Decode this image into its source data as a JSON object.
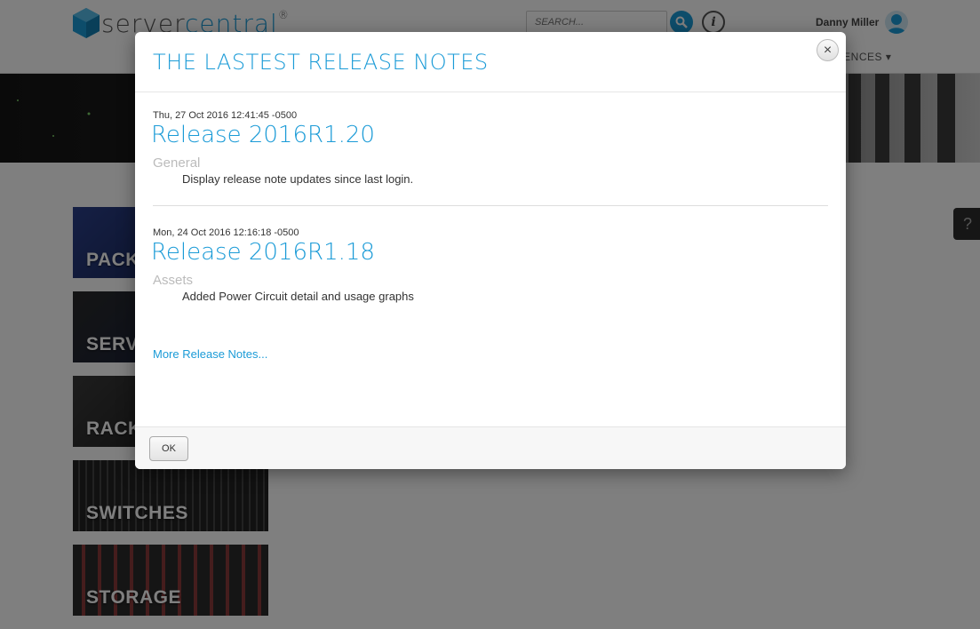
{
  "header": {
    "logo_prefix": "server",
    "logo_suffix": "central",
    "logo_mark": "®",
    "search_placeholder": "SEARCH...",
    "user_name": "Danny Miller",
    "nav_preferences": "RENCES"
  },
  "tiles": [
    {
      "label": "PACK"
    },
    {
      "label": "SERV"
    },
    {
      "label": "RACK"
    },
    {
      "label": "SWITCHES"
    },
    {
      "label": "STORAGE"
    }
  ],
  "help_tab": "?",
  "modal": {
    "title": "THE LASTEST RELEASE NOTES",
    "close_symbol": "×",
    "notes": [
      {
        "date": "Thu, 27 Oct 2016 12:41:45 -0500",
        "release": "Release 2016R1.20",
        "section": "General",
        "item": "Display release note updates since last login."
      },
      {
        "date": "Mon, 24 Oct 2016 12:16:18 -0500",
        "release": "Release 2016R1.18",
        "section": "Assets",
        "item": "Added Power Circuit detail and usage graphs"
      }
    ],
    "more_link": "More Release Notes...",
    "ok_label": "OK"
  },
  "colors": {
    "accent": "#1b9bd7",
    "overlay": "rgba(0,0,0,0.5)"
  },
  "icons": {
    "search": "magnifier-icon",
    "info": "info-icon",
    "avatar": "user-avatar-icon",
    "close": "close-icon",
    "nav_caret": "caret-down-icon"
  }
}
